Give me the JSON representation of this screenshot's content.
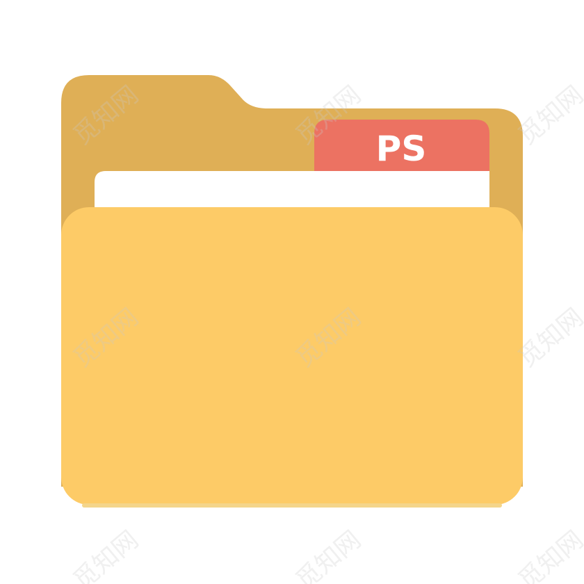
{
  "icon": {
    "name": "folder-icon",
    "badge_label": "PS"
  },
  "watermark": {
    "text": "觅知网"
  },
  "colors": {
    "folder_back": "#DFAF56",
    "folder_front": "#FDCB67",
    "paper": "#FFFFFF",
    "badge": "#EC7262",
    "badge_text": "#FFFFFF",
    "watermark": "#C8C8C8"
  }
}
